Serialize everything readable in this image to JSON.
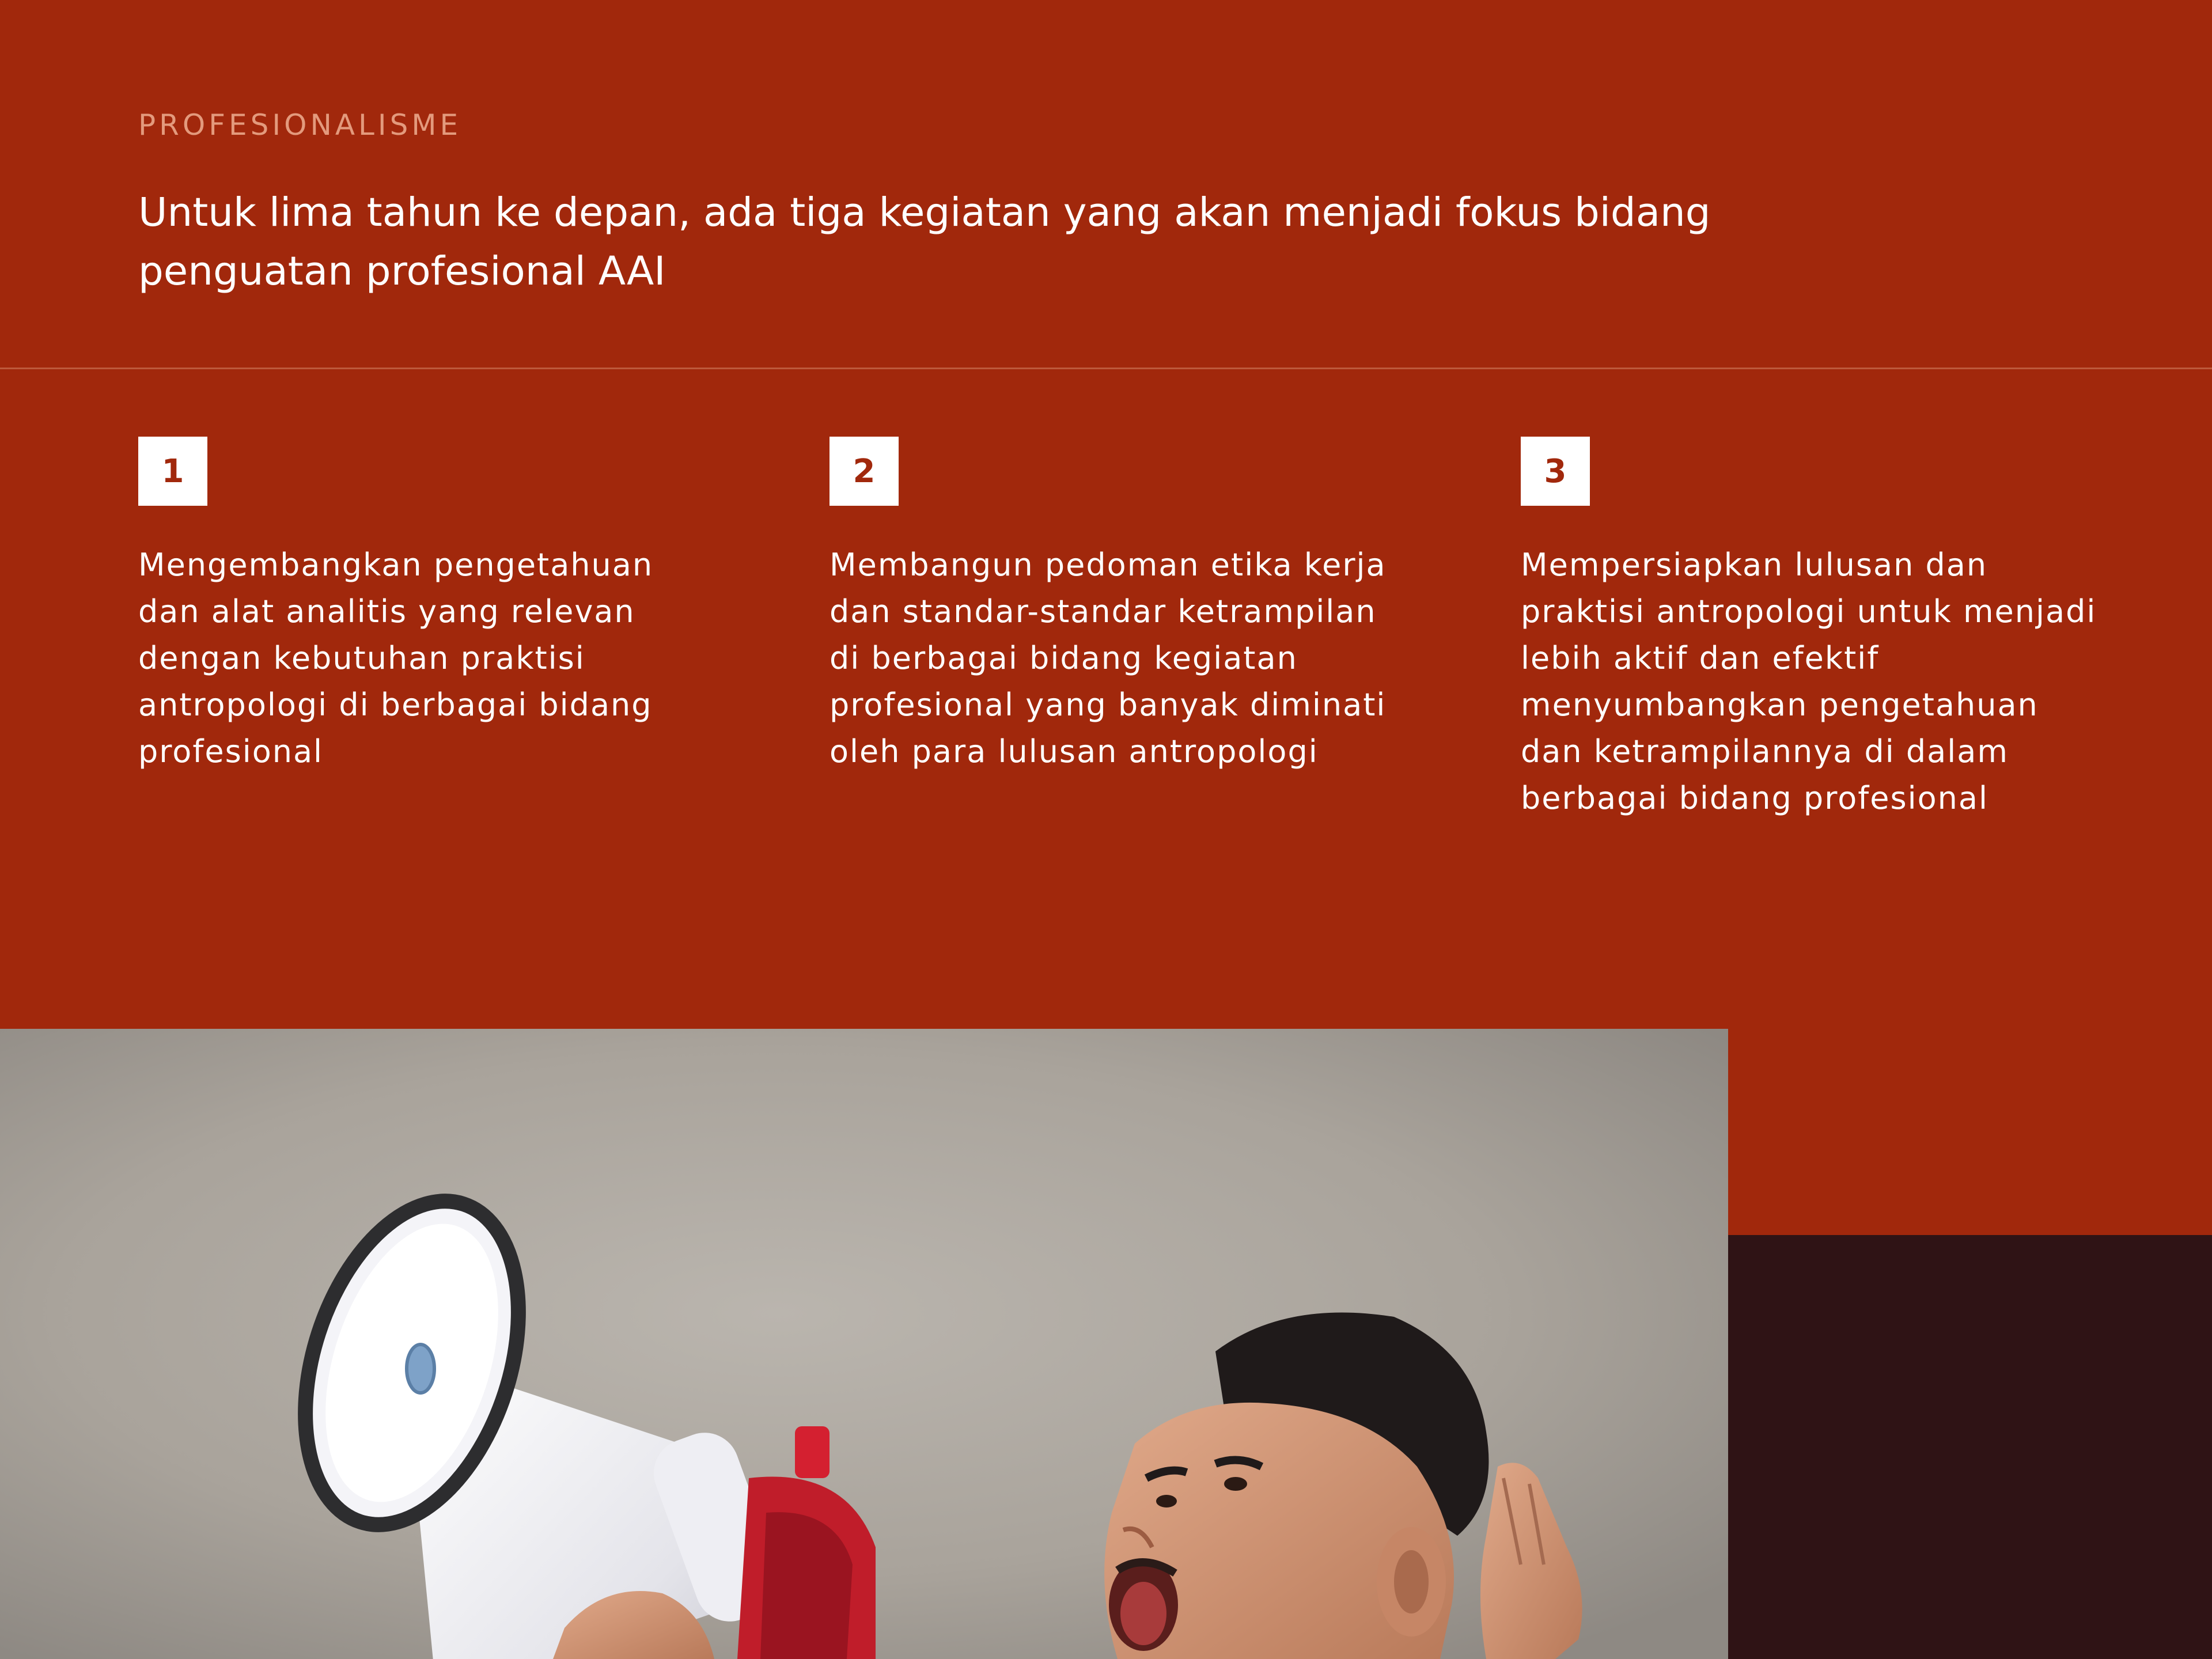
{
  "section": {
    "eyebrow": "PROFESIONALISME",
    "headline": "Untuk lima tahun ke depan, ada tiga kegiatan yang akan menjadi fokus bidang penguatan profesional AAI"
  },
  "items": [
    {
      "number": "1",
      "text": "Mengembangkan pengetahuan dan alat analitis yang relevan dengan kebutuhan praktisi antropologi di berbagai bidang profesional"
    },
    {
      "number": "2",
      "text": "Membangun pedoman etika kerja dan standar-standar ketrampilan di berbagai bidang kegiatan profesional yang banyak diminati oleh para lulusan antropologi"
    },
    {
      "number": "3",
      "text": "Mempersiapkan lulusan dan praktisi antropologi untuk menjadi lebih aktif dan efektif menyumbangkan pengetahuan dan ketrampilannya di dalam berbagai bidang profesional"
    }
  ],
  "colors": {
    "primary_red": "#a1280c",
    "dark_maroon": "#2f1315",
    "eyebrow": "#e39a7d",
    "white": "#ffffff"
  },
  "image": {
    "icon": "megaphone-photo"
  }
}
